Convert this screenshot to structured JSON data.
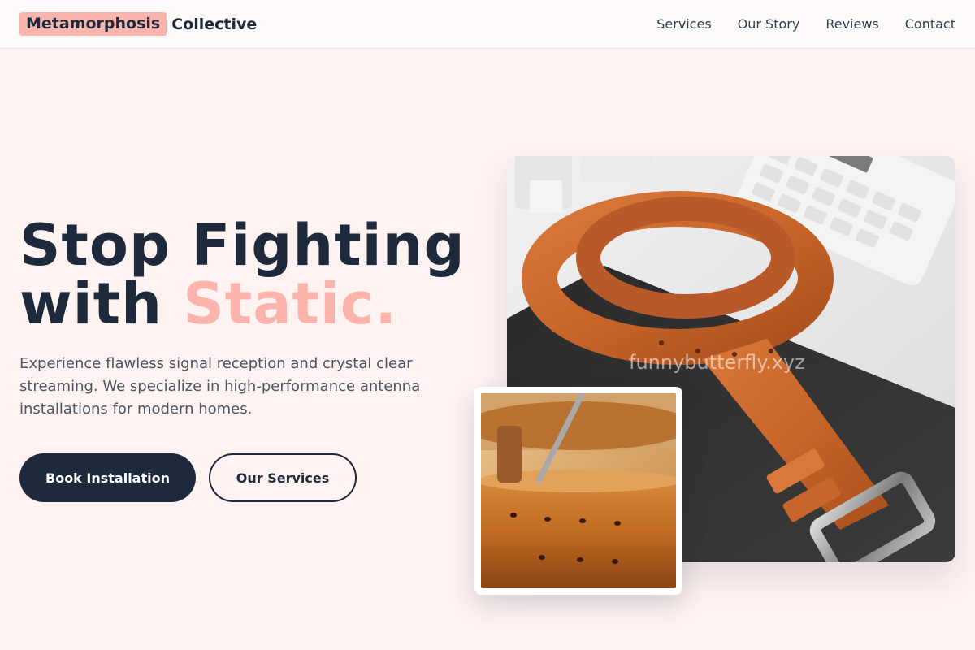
{
  "nav": {
    "brand_highlight": "Metamorphosis",
    "brand_rest": "Collective",
    "links": [
      "Services",
      "Our Story",
      "Reviews",
      "Contact"
    ]
  },
  "hero": {
    "title_line1": "Stop Fighting",
    "title_line2_plain": "with ",
    "title_line2_accent": "Static.",
    "subtitle": "Experience flawless signal reception and crystal clear streaming. We specialize in high-performance antenna installations for modern homes.",
    "primary_button": "Book Installation",
    "secondary_button": "Our Services"
  },
  "images": {
    "main_watermark": "funnybutterfly.xyz"
  },
  "colors": {
    "navy": "#1e293b",
    "accent_pink": "#fdb4ad",
    "background": "#fff3f2"
  }
}
